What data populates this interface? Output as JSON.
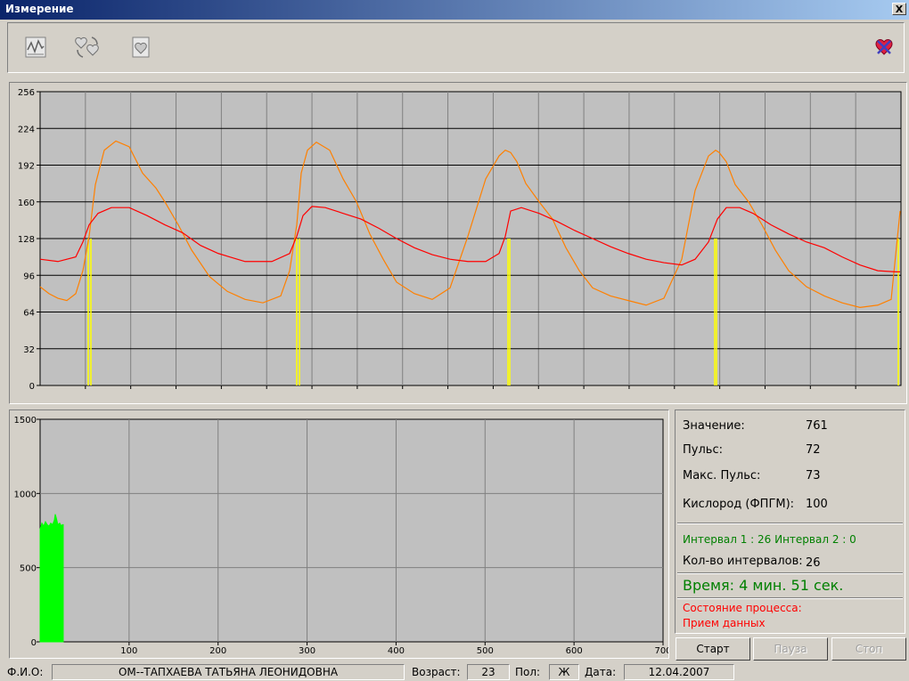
{
  "window": {
    "title": "Измерение",
    "close_label": "X"
  },
  "toolbar": {
    "icons": [
      "chart-doc-icon",
      "hearts-refresh-icon",
      "heart-doc-icon",
      "heart-cross-icon"
    ]
  },
  "chart_data": [
    {
      "type": "line",
      "ylim": [
        0,
        256
      ],
      "yticks": [
        "0",
        "32",
        "64",
        "96",
        "128",
        "160",
        "192",
        "224",
        "256"
      ],
      "series": [
        {
          "color": "#ff8000",
          "x": [
            0,
            10,
            20,
            30,
            40,
            48,
            55,
            62,
            72,
            85,
            100,
            115,
            130,
            140,
            155,
            170,
            190,
            210,
            230,
            250,
            270,
            280,
            288,
            293,
            300,
            310,
            325,
            340,
            355,
            370,
            385,
            400,
            420,
            440,
            460,
            480,
            500,
            515,
            522,
            528,
            535,
            545,
            560,
            575,
            590,
            605,
            620,
            640,
            660,
            680,
            700,
            720,
            735,
            750,
            758,
            762,
            770,
            780,
            795,
            810,
            825,
            840,
            860,
            880,
            900,
            920,
            940,
            955,
            965
          ],
          "y": [
            86,
            80,
            76,
            74,
            80,
            100,
            130,
            175,
            205,
            213,
            208,
            185,
            172,
            160,
            140,
            118,
            95,
            82,
            75,
            72,
            78,
            100,
            140,
            185,
            205,
            212,
            205,
            180,
            160,
            132,
            110,
            90,
            80,
            75,
            85,
            130,
            180,
            200,
            205,
            203,
            195,
            176,
            160,
            145,
            120,
            100,
            85,
            78,
            74,
            70,
            76,
            110,
            170,
            200,
            205,
            203,
            195,
            175,
            160,
            140,
            118,
            100,
            86,
            78,
            72,
            68,
            70,
            75,
            152
          ]
        },
        {
          "color": "#ff0000",
          "x": [
            0,
            20,
            40,
            48,
            55,
            65,
            80,
            100,
            120,
            140,
            160,
            180,
            200,
            230,
            260,
            280,
            288,
            295,
            305,
            320,
            340,
            360,
            380,
            400,
            420,
            440,
            460,
            480,
            500,
            515,
            522,
            528,
            540,
            560,
            580,
            600,
            620,
            640,
            660,
            680,
            700,
            720,
            735,
            750,
            760,
            770,
            785,
            800,
            820,
            840,
            860,
            880,
            900,
            920,
            940,
            960,
            965
          ],
          "y": [
            110,
            108,
            112,
            125,
            140,
            150,
            155,
            155,
            148,
            140,
            133,
            122,
            115,
            108,
            108,
            115,
            130,
            148,
            156,
            155,
            150,
            145,
            137,
            128,
            120,
            114,
            110,
            108,
            108,
            115,
            130,
            152,
            155,
            150,
            143,
            135,
            128,
            121,
            115,
            110,
            107,
            105,
            110,
            125,
            145,
            155,
            155,
            150,
            140,
            132,
            125,
            120,
            112,
            105,
            100,
            99,
            99
          ]
        }
      ],
      "markers_x": [
        54,
        57,
        288,
        291,
        525,
        527,
        757,
        759,
        963
      ]
    },
    {
      "type": "area",
      "xlim": [
        0,
        700
      ],
      "ylim": [
        0,
        1500
      ],
      "xticks": [
        "100",
        "200",
        "300",
        "400",
        "500",
        "600",
        "700"
      ],
      "yticks": [
        "0",
        "500",
        "1000",
        "1500"
      ],
      "color": "#00ff00",
      "x": [
        0,
        2,
        4,
        6,
        8,
        10,
        12,
        14,
        16,
        17,
        18,
        20,
        22,
        24,
        25,
        26
      ],
      "y": [
        760,
        800,
        780,
        810,
        790,
        780,
        800,
        790,
        820,
        860,
        840,
        790,
        800,
        780,
        790,
        790
      ]
    }
  ],
  "info": {
    "value_label": "Значение:",
    "value": "761",
    "pulse_label": "Пульс:",
    "pulse": "72",
    "max_pulse_label": "Макс. Пульс:",
    "max_pulse": "73",
    "oxygen_label": "Кислород (ФПГМ):",
    "oxygen": "100",
    "intervals_text": "Интервал 1 : 26  Интервал 2 : 0",
    "interval_count_label": "Кол-во интервалов:",
    "interval_count": "26",
    "time_text": "Время:  4 мин. 51 сек.",
    "process_label": "Состояние процесса:",
    "process_value": "Прием данных",
    "colors": {
      "green": "#008000",
      "red": "#ff0000"
    }
  },
  "buttons": {
    "start": "Старт",
    "pause": "Пауза",
    "stop": "Стоп"
  },
  "statusbar": {
    "name_label": "Ф.И.О:",
    "name": "ОМ--ТАПХАЕВА  ТАТЬЯНА  ЛЕОНИДОВНА",
    "age_label": "Возраст:",
    "age": "23",
    "sex_label": "Пол:",
    "sex": "Ж",
    "date_label": "Дата:",
    "date": "12.04.2007"
  }
}
